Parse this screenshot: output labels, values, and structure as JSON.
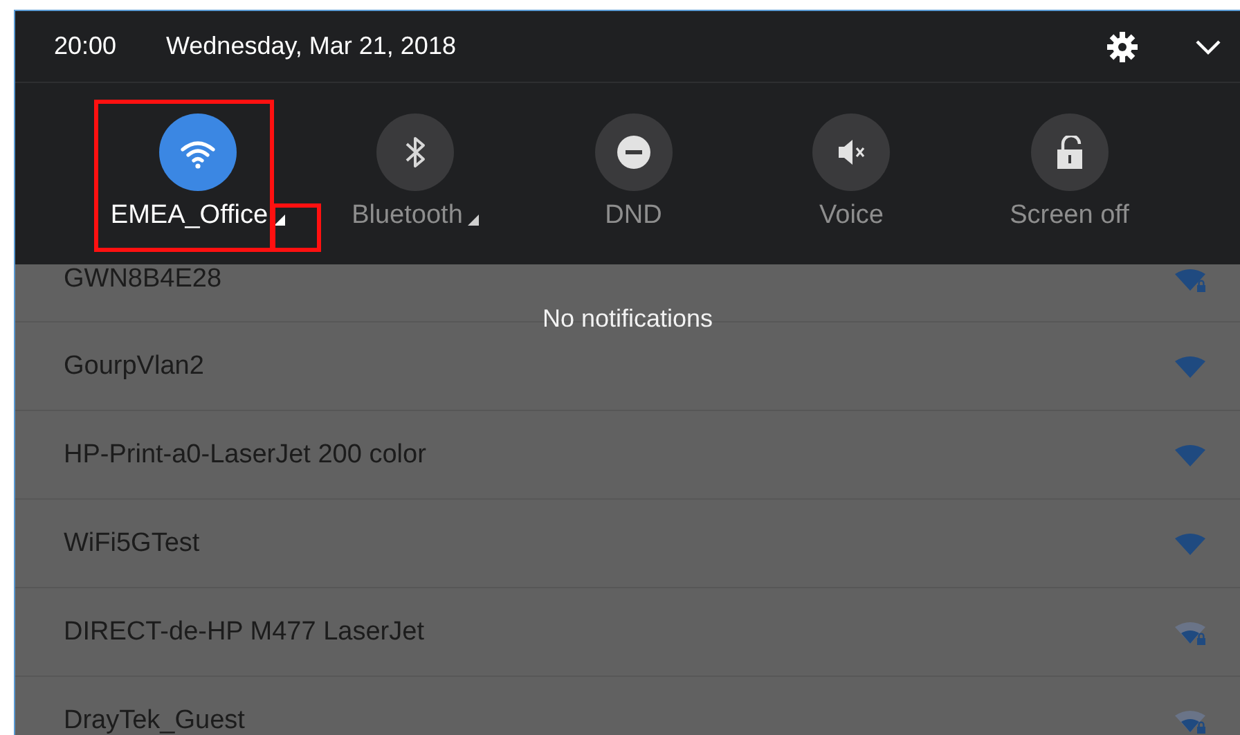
{
  "status_bar": {
    "time": "20:00",
    "date": "Wednesday, Mar 21, 2018"
  },
  "quick_tiles": [
    {
      "kind": "wifi",
      "label": "EMEA_Office",
      "on": true,
      "has_menu": true,
      "highlighted": true
    },
    {
      "kind": "bluetooth",
      "label": "Bluetooth",
      "on": false,
      "has_menu": true,
      "highlighted": false
    },
    {
      "kind": "dnd",
      "label": "DND",
      "on": false,
      "has_menu": false,
      "highlighted": false
    },
    {
      "kind": "voice",
      "label": "Voice",
      "on": false,
      "has_menu": false,
      "highlighted": false
    },
    {
      "kind": "screen_off",
      "label": "Screen off",
      "on": false,
      "has_menu": false,
      "highlighted": false
    }
  ],
  "notifications": {
    "empty_text": "No notifications"
  },
  "networks": [
    {
      "name": "GWN8B4E28",
      "kind": "strong",
      "secured": true
    },
    {
      "name": "GourpVlan2",
      "kind": "strong",
      "secured": false
    },
    {
      "name": "HP-Print-a0-LaserJet 200 color",
      "kind": "strong",
      "secured": false
    },
    {
      "name": "WiFi5GTest",
      "kind": "strong",
      "secured": false
    },
    {
      "name": "DIRECT-de-HP M477 LaserJet",
      "kind": "weak",
      "secured": true
    },
    {
      "name": "DrayTek_Guest",
      "kind": "weak",
      "secured": true
    }
  ]
}
